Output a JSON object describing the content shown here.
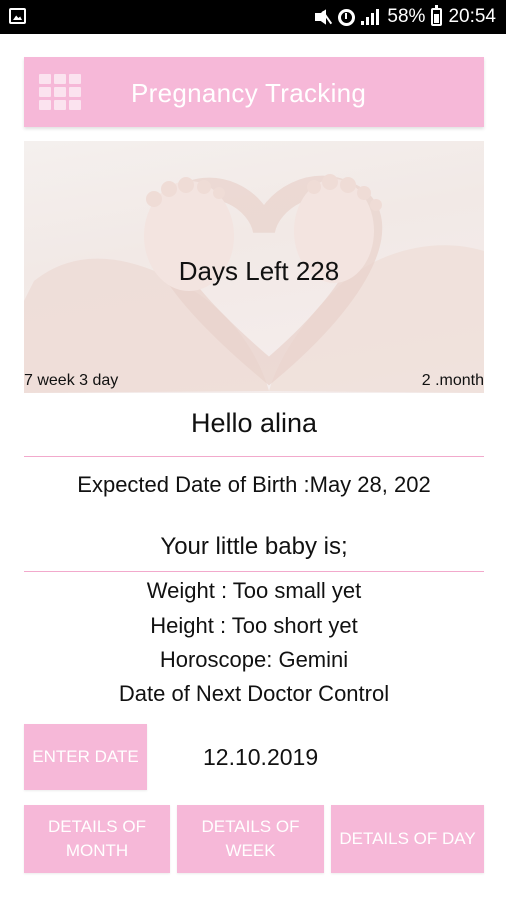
{
  "status_bar": {
    "battery": "58%",
    "time": "20:54",
    "icons": [
      "image-icon",
      "mute-icon",
      "alarm-icon",
      "signal-icon",
      "battery-icon"
    ]
  },
  "app_bar": {
    "title": "Pregnancy Tracking",
    "menu_icon": "grid-menu-icon",
    "color": "#f6b8d8"
  },
  "hero": {
    "days_left": "Days Left 228",
    "week_day": "7 week 3 day",
    "month": "2 .month"
  },
  "greeting": "Hello alina",
  "expected_birth": "Expected Date of Birth :May 28, 202",
  "baby_heading": "Your little baby is;",
  "baby_info": {
    "weight": "Weight : Too small yet",
    "height": "Height : Too short yet",
    "horoscope": "Horoscope: Gemini",
    "next_control": "Date of Next Doctor Control"
  },
  "enter_date": {
    "label": "ENTER DATE",
    "value": "12.10.2019"
  },
  "buttons": {
    "details_month": "DETAILS OF MONTH",
    "details_week": "DETAILS OF WEEK",
    "details_day": "DETAILS OF DAY"
  },
  "colors": {
    "accent": "#f6b8d8",
    "divider": "#f2a9cc"
  }
}
